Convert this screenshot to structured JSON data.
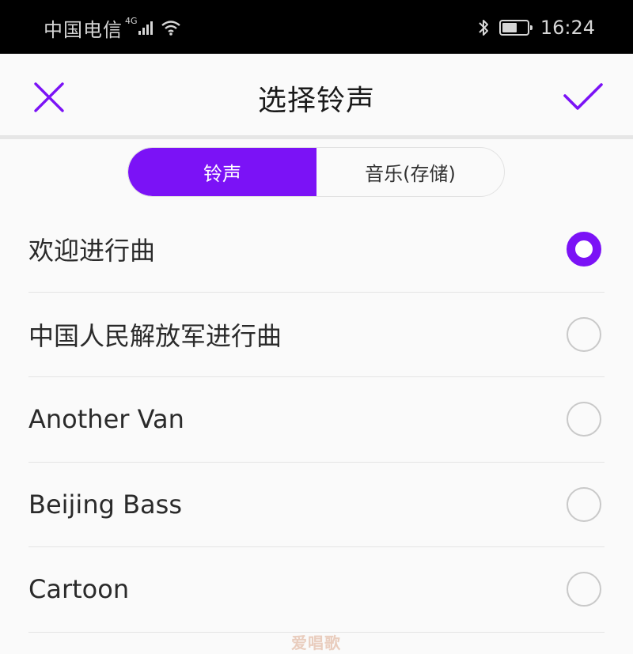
{
  "status_bar": {
    "carrier": "中国电信",
    "network_type": "4G",
    "time": "16:24",
    "icons": [
      "signal-icon",
      "wifi-icon",
      "bluetooth-icon",
      "battery-icon"
    ]
  },
  "header": {
    "title": "选择铃声",
    "close_icon": "close-icon",
    "confirm_icon": "check-icon"
  },
  "tabs": [
    {
      "label": "铃声",
      "active": true
    },
    {
      "label": "音乐(存储)",
      "active": false
    }
  ],
  "ringtones": [
    {
      "name": "欢迎进行曲",
      "selected": true
    },
    {
      "name": "中国人民解放军进行曲",
      "selected": false
    },
    {
      "name": "Another Van",
      "selected": false
    },
    {
      "name": "Beijing Bass",
      "selected": false
    },
    {
      "name": "Cartoon",
      "selected": false
    }
  ],
  "watermark": "爱唱歌",
  "colors": {
    "accent": "#7b12f6",
    "status_bar_bg": "#000000",
    "background": "#fafafa",
    "divider": "#e4e4e4"
  }
}
